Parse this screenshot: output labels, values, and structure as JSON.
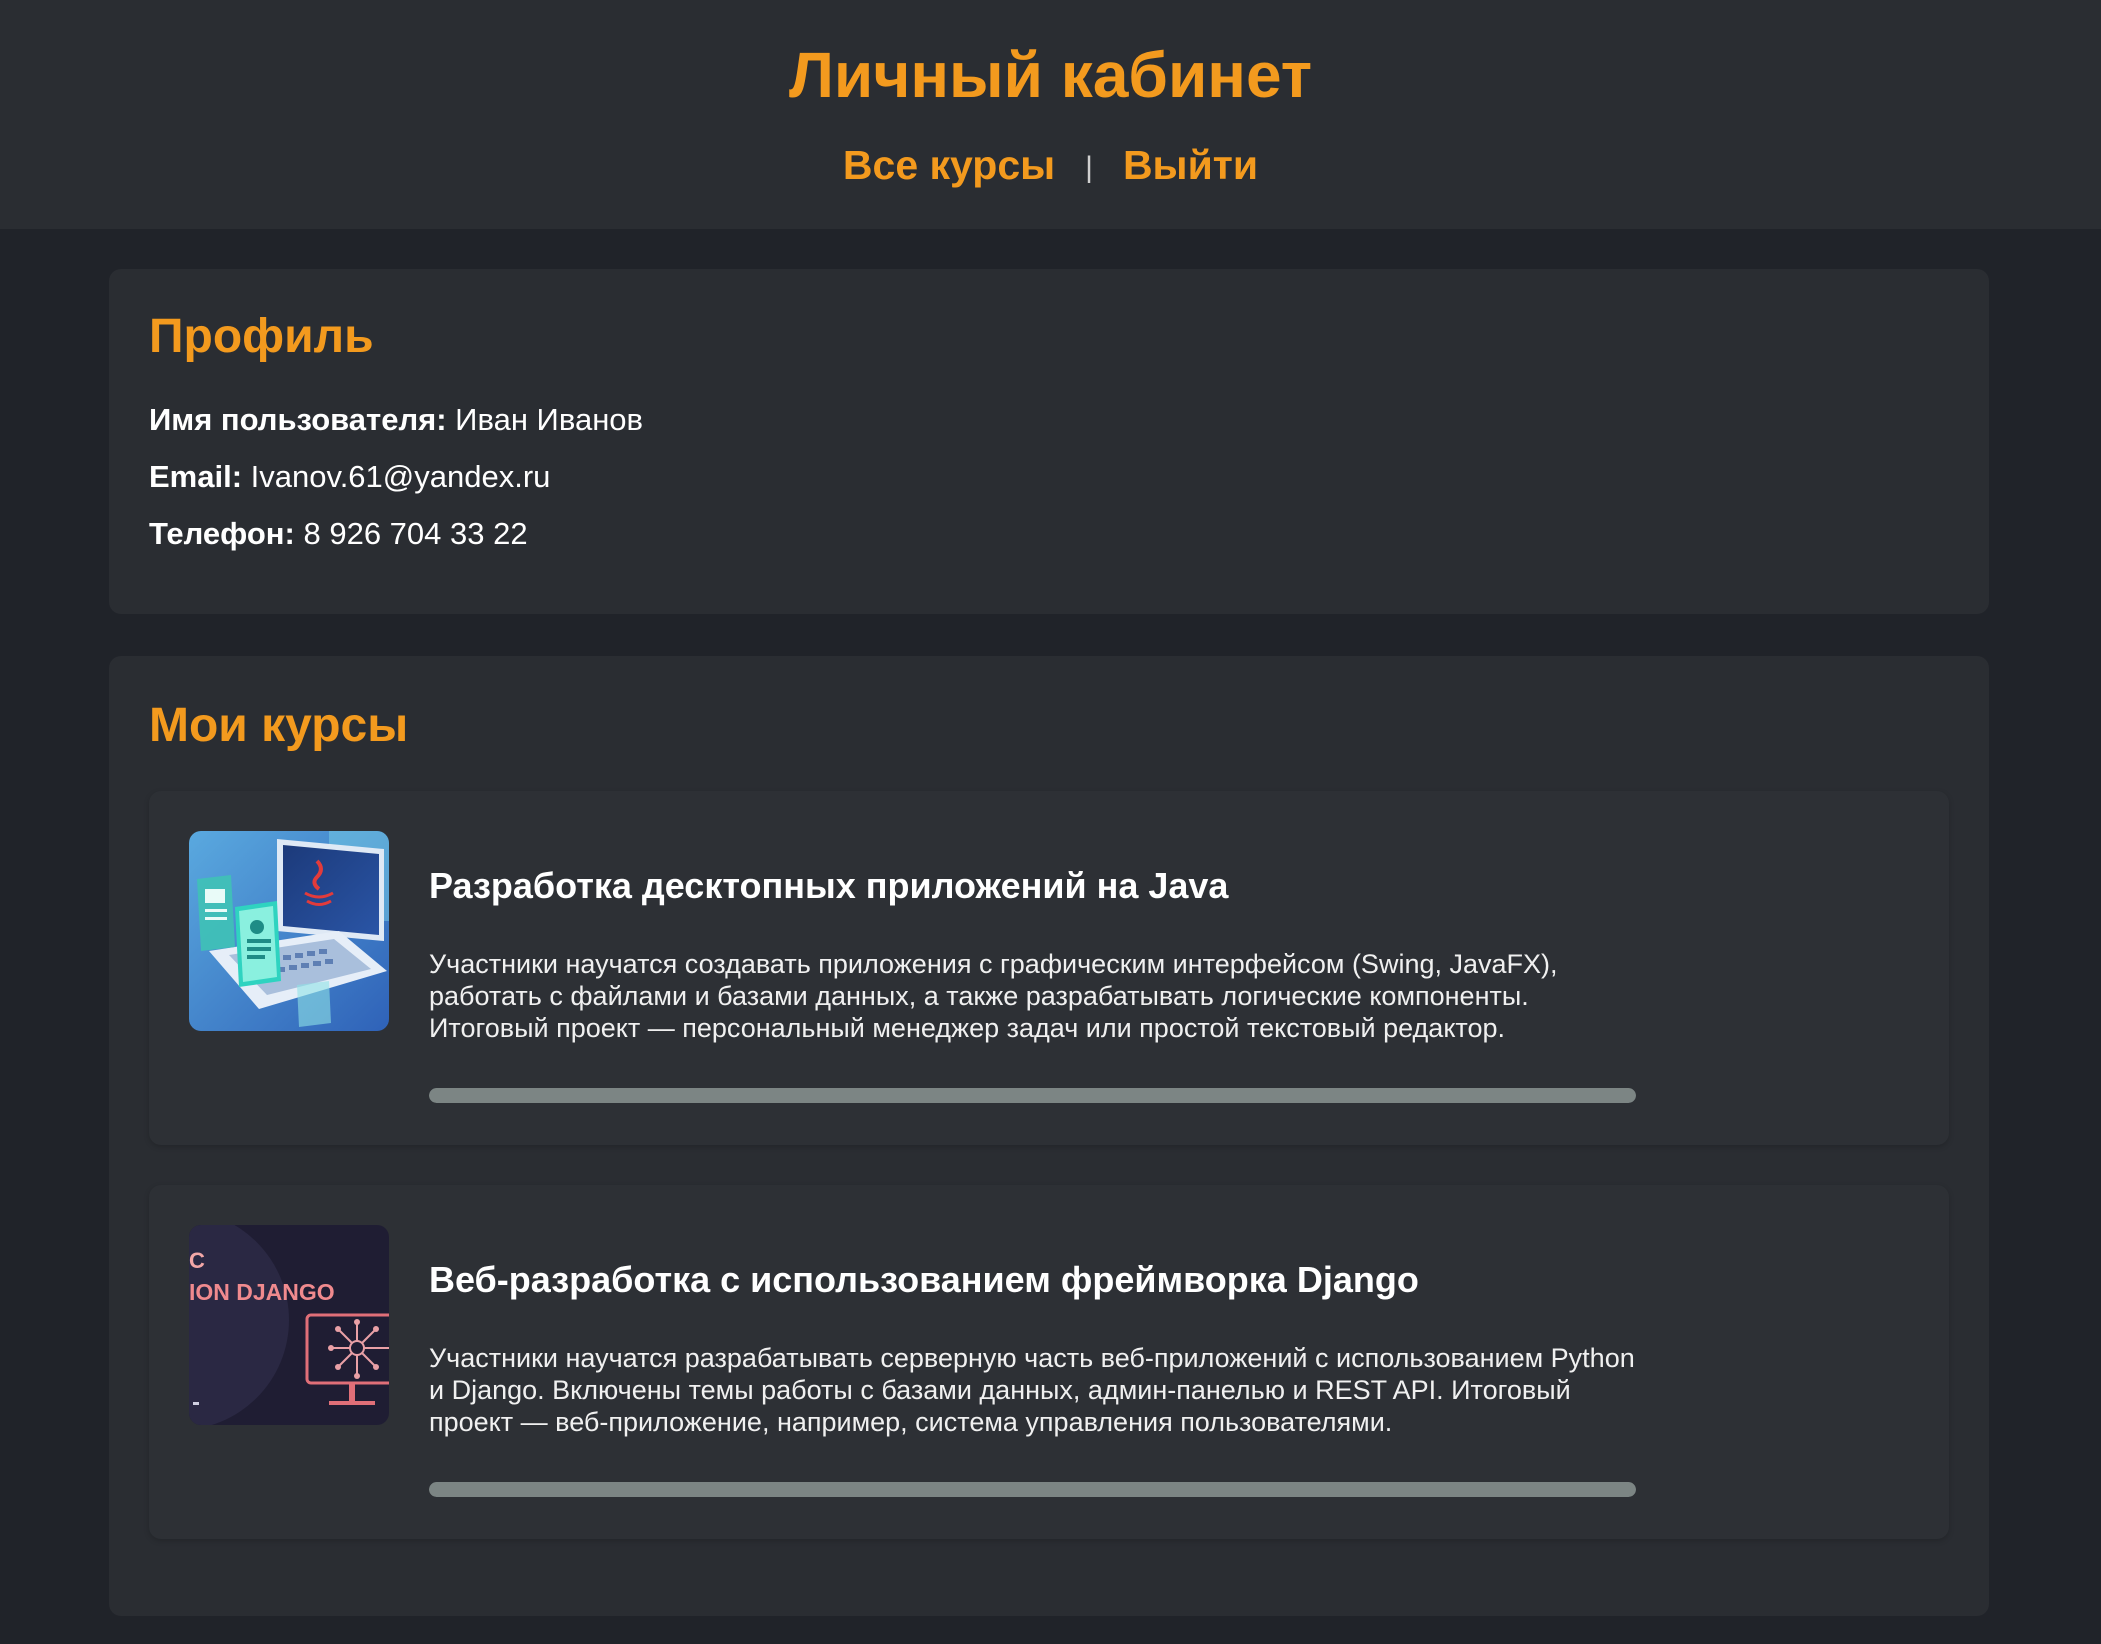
{
  "header": {
    "title": "Личный кабинет",
    "nav": {
      "all_courses": "Все курсы",
      "separator": "|",
      "logout": "Выйти"
    }
  },
  "profile": {
    "heading": "Профиль",
    "username_label": "Имя пользователя:",
    "username_value": "Иван Иванов",
    "email_label": "Email:",
    "email_value": "Ivanov.61@yandex.ru",
    "phone_label": "Телефон:",
    "phone_value": "8 926 704 33 22"
  },
  "courses": {
    "heading": "Мои курсы",
    "items": [
      {
        "title": "Разработка десктопных приложений на Java",
        "description": "Участники научатся создавать приложения с графическим интерфейсом (Swing, JavaFX), работать с файлами и базами данных, а также разрабатывать логические компоненты. Итоговый проект — персональный менеджер задач или простой текстовый редактор.",
        "image_text": "Java",
        "image_icon": "java-laptop-illustration",
        "progress": 1.0
      },
      {
        "title": "Веб-разработка с использованием фреймворка Django",
        "description": "Участники научатся разрабатывать серверную часть веб-приложений с использованием Python и Django. Включены темы работы с базами данных, админ-панелью и REST API. Итоговый проект — веб-приложение, например, система управления пользователями.",
        "image_text": "ION DJANGO",
        "image_icon": "django-monitor-illustration",
        "progress": 1.0
      }
    ]
  },
  "colors": {
    "accent": "#f39a1e",
    "page_background": "#202329",
    "card_background": "#2a2d32",
    "course_background": "#2d3035",
    "progress_fill": "#7c8584"
  }
}
